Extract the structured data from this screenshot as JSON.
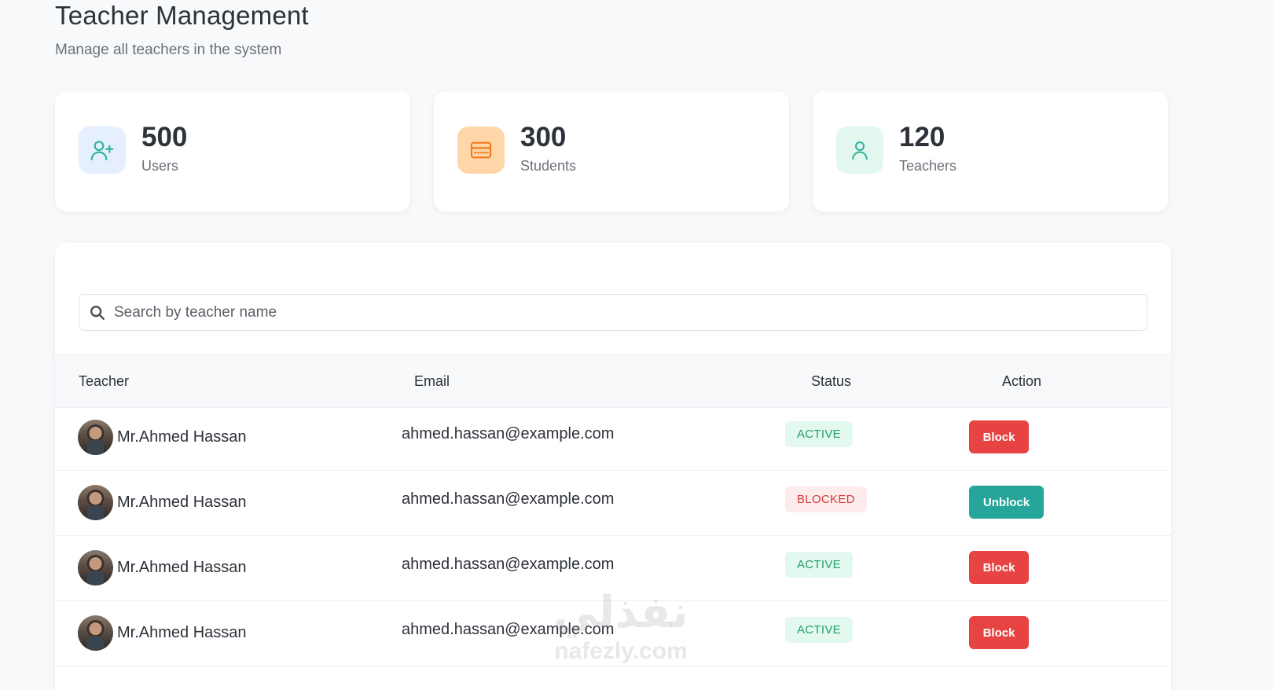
{
  "header": {
    "title": "Teacher Management",
    "subtitle": "Manage all teachers in the system"
  },
  "stats": [
    {
      "value": "500",
      "label": "Users",
      "icon": "user-plus-icon",
      "color": "#2bb39a"
    },
    {
      "value": "300",
      "label": "Students",
      "icon": "ticket-icon",
      "color": "#f27a1a"
    },
    {
      "value": "120",
      "label": "Teachers",
      "icon": "user-icon",
      "color": "#2bb39a"
    }
  ],
  "search": {
    "placeholder": "Search by teacher name"
  },
  "table": {
    "columns": [
      "Teacher",
      "Email",
      "Status",
      "Action"
    ],
    "rows": [
      {
        "name": "Mr.Ahmed Hassan",
        "email": "ahmed.hassan@example.com",
        "status": "ACTIVE",
        "action": "Block"
      },
      {
        "name": "Mr.Ahmed Hassan",
        "email": "ahmed.hassan@example.com",
        "status": "BLOCKED",
        "action": "Unblock"
      },
      {
        "name": "Mr.Ahmed Hassan",
        "email": "ahmed.hassan@example.com",
        "status": "ACTIVE",
        "action": "Block"
      },
      {
        "name": "Mr.Ahmed Hassan",
        "email": "ahmed.hassan@example.com",
        "status": "ACTIVE",
        "action": "Block"
      }
    ]
  },
  "watermark": {
    "arabic": "نفذلي",
    "latin": "nafezly.com"
  },
  "colors": {
    "active_bg": "#e3f8ee",
    "active_text": "#22a06b",
    "blocked_bg": "#fdecec",
    "blocked_text": "#d93c3c",
    "block_button": "#e84343",
    "unblock_button": "#26a69a"
  }
}
